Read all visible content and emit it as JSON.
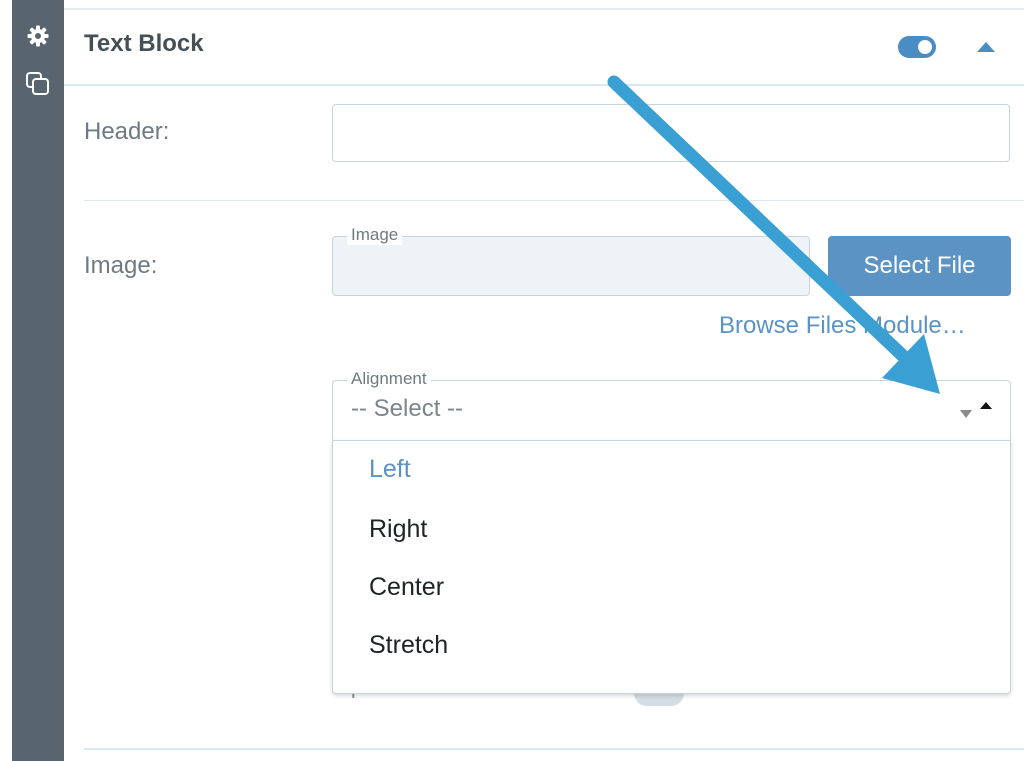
{
  "panel": {
    "title": "Text Block"
  },
  "fields": {
    "header": {
      "label": "Header:",
      "value": ""
    },
    "image": {
      "label": "Image:",
      "floating_label": "Image",
      "select_button": "Select File",
      "browse_link": "Browse Files Module…"
    },
    "alignment": {
      "floating_label": "Alignment",
      "value": "-- Select --",
      "options": [
        "Left",
        "Right",
        "Center",
        "Stretch"
      ],
      "highlighted": "Left"
    },
    "new_window": {
      "label": "Open in New Window?",
      "enabled": false
    }
  },
  "colors": {
    "accent": "#5b93c4",
    "rail": "#59656e",
    "annotation_arrow": "#3aa0d4"
  },
  "icons": {
    "rail": [
      "gear-icon",
      "copy-icon"
    ],
    "header_controls": [
      "toggle-switch",
      "chevron-up-icon"
    ],
    "select_arrows": "sort-arrows-icon"
  }
}
